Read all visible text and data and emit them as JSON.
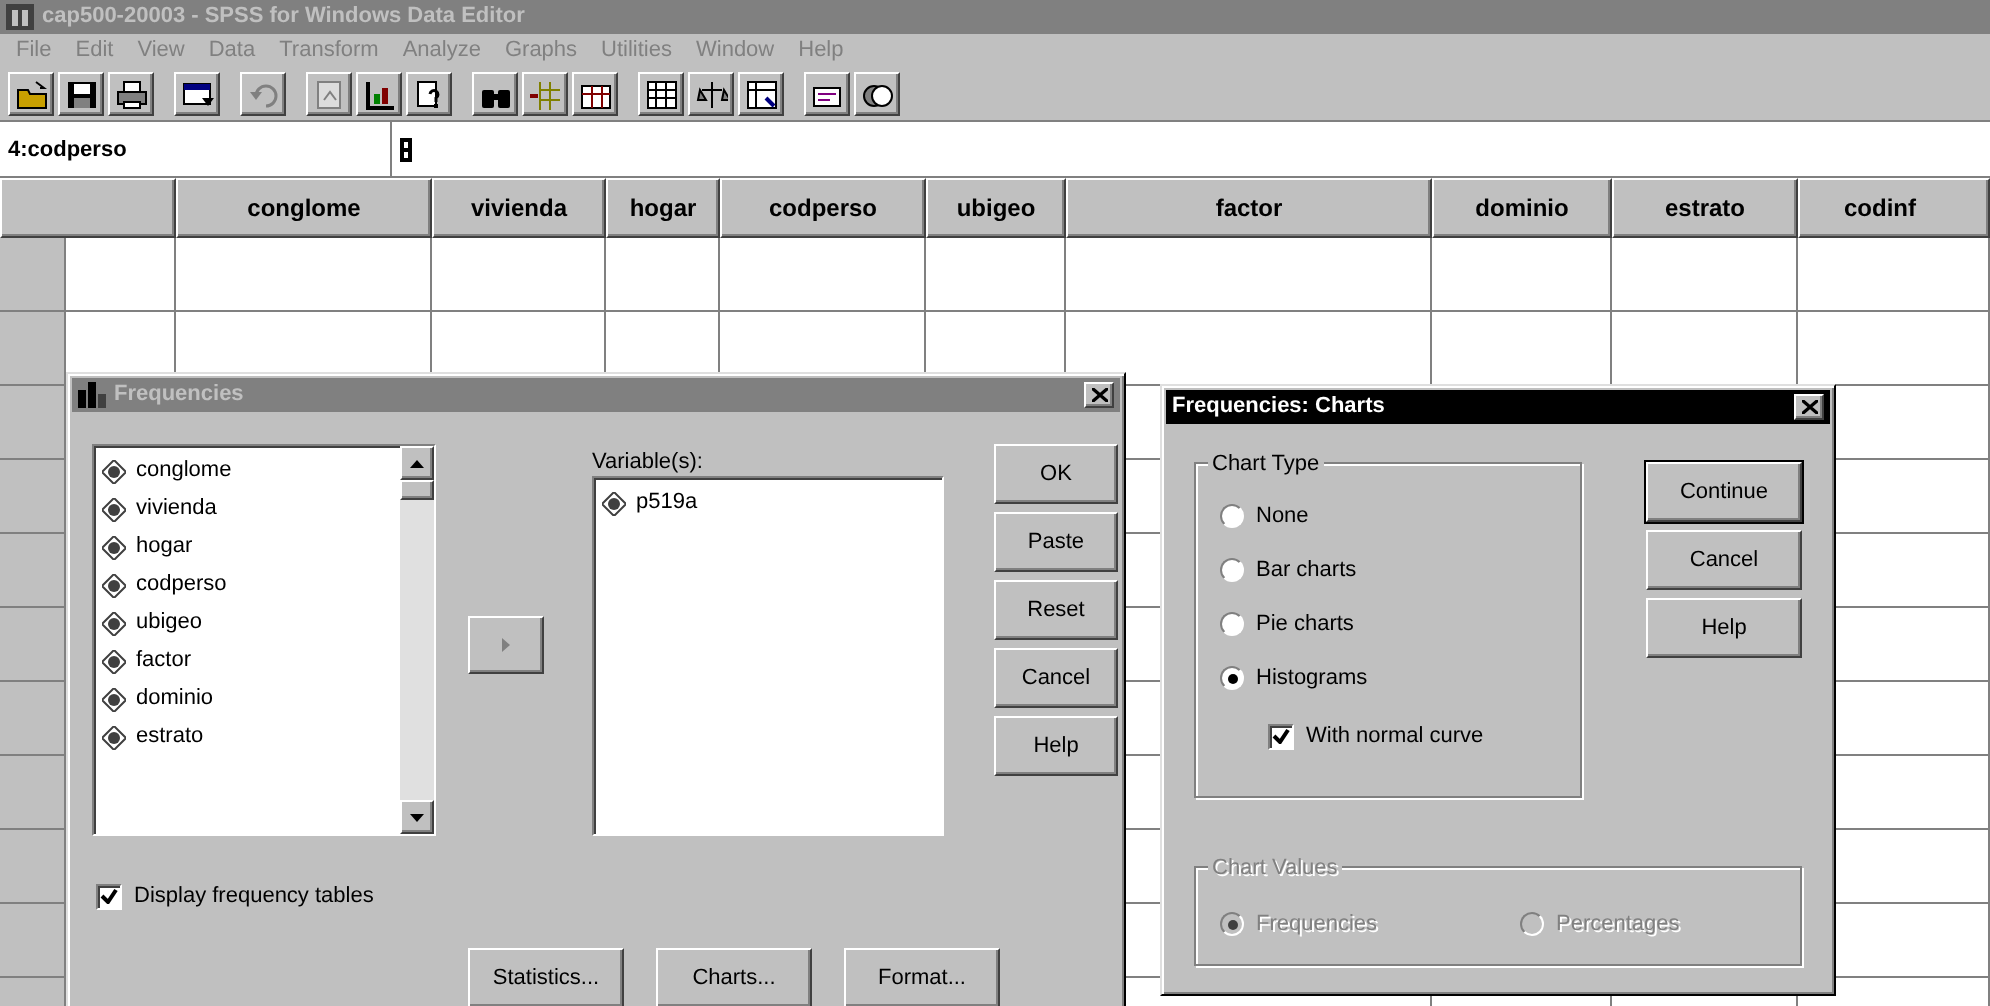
{
  "window": {
    "title": "cap500-20003 - SPSS for Windows Data Editor",
    "active": false
  },
  "menu": [
    {
      "label": "File"
    },
    {
      "label": "Edit"
    },
    {
      "label": "View"
    },
    {
      "label": "Data"
    },
    {
      "label": "Transform"
    },
    {
      "label": "Analyze"
    },
    {
      "label": "Graphs"
    },
    {
      "label": "Utilities"
    },
    {
      "label": "Window"
    },
    {
      "label": "Help"
    }
  ],
  "cell_editor": {
    "cell": "4:codperso"
  },
  "columns": [
    "conglome",
    "vivienda",
    "hogar",
    "codperso",
    "ubigeo",
    "factor",
    "dominio",
    "estrato",
    "codinf"
  ],
  "frequencies_dialog": {
    "title": "Frequencies",
    "active": false,
    "source_variables": [
      "conglome",
      "vivienda",
      "hogar",
      "codperso",
      "ubigeo",
      "factor",
      "dominio",
      "estrato"
    ],
    "target_label": "Variable(s):",
    "target_variables": [
      "p519a"
    ],
    "buttons": [
      "OK",
      "Paste",
      "Reset",
      "Cancel",
      "Help"
    ],
    "display_tables": {
      "label": "Display frequency tables",
      "checked": true
    },
    "bottom_buttons": [
      "Statistics...",
      "Charts...",
      "Format..."
    ]
  },
  "charts_dialog": {
    "title": "Frequencies: Charts",
    "active": true,
    "chart_type": {
      "label": "Chart Type",
      "options": [
        {
          "label": "None",
          "selected": false
        },
        {
          "label": "Bar charts",
          "selected": false
        },
        {
          "label": "Pie charts",
          "selected": false
        },
        {
          "label": "Histograms",
          "selected": true
        }
      ]
    },
    "normal_curve": {
      "label": "With normal curve",
      "checked": true
    },
    "buttons": [
      "Continue",
      "Cancel",
      "Help"
    ],
    "chart_values": {
      "label": "Chart Values",
      "disabled": true,
      "options": [
        {
          "label": "Frequencies",
          "selected": true
        },
        {
          "label": "Percentages",
          "selected": false
        }
      ]
    }
  }
}
